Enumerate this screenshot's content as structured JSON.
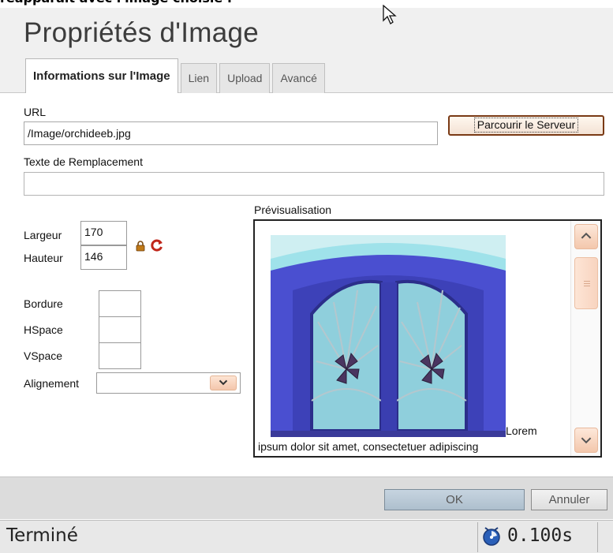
{
  "caption": "réapparaît avec l'image choisie :",
  "dialog": {
    "title": "Propriétés d'Image",
    "tabs": [
      {
        "label": "Informations sur l'Image",
        "active": true
      },
      {
        "label": "Lien",
        "active": false
      },
      {
        "label": "Upload",
        "active": false
      },
      {
        "label": "Avancé",
        "active": false
      }
    ]
  },
  "form": {
    "url_label": "URL",
    "url_value": "/Image/orchideeb.jpg",
    "browse_label": "Parcourir le Serveur",
    "alt_label": "Texte de Remplacement",
    "alt_value": "",
    "width_label": "Largeur",
    "width_value": "170",
    "height_label": "Hauteur",
    "height_value": "146",
    "border_label": "Bordure",
    "border_value": "",
    "hspace_label": "HSpace",
    "hspace_value": "",
    "vspace_label": "VSpace",
    "vspace_value": "",
    "align_label": "Alignement",
    "align_value": ""
  },
  "preview": {
    "label": "Prévisualisation",
    "text_line1": "Lorem",
    "text_line2": "ipsum dolor sit amet, consectetuer adipiscing"
  },
  "footer": {
    "ok_label": "OK",
    "cancel_label": "Annuler"
  },
  "status": {
    "text": "Terminé",
    "time": "0.100s"
  },
  "colors": {
    "accent": "#7a3a15",
    "scroll": "#f3c7ac",
    "ok_button": "#b9c8d5"
  }
}
